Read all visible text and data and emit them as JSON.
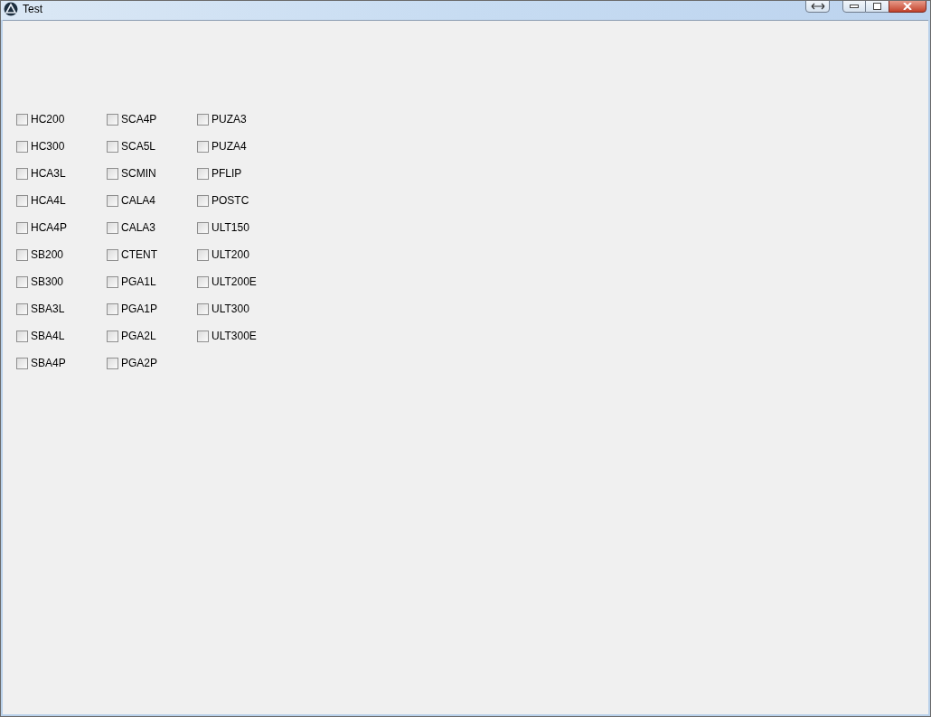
{
  "window": {
    "title": "Test"
  },
  "checkbox_columns": [
    [
      {
        "label": "HC200",
        "checked": false
      },
      {
        "label": "HC300",
        "checked": false
      },
      {
        "label": "HCA3L",
        "checked": false
      },
      {
        "label": "HCA4L",
        "checked": false
      },
      {
        "label": "HCA4P",
        "checked": false
      },
      {
        "label": "SB200",
        "checked": false
      },
      {
        "label": "SB300",
        "checked": false
      },
      {
        "label": "SBA3L",
        "checked": false
      },
      {
        "label": "SBA4L",
        "checked": false
      },
      {
        "label": "SBA4P",
        "checked": false
      }
    ],
    [
      {
        "label": "SCA4P",
        "checked": false
      },
      {
        "label": "SCA5L",
        "checked": false
      },
      {
        "label": "SCMIN",
        "checked": false
      },
      {
        "label": "CALA4",
        "checked": false
      },
      {
        "label": "CALA3",
        "checked": false
      },
      {
        "label": "CTENT",
        "checked": false
      },
      {
        "label": "PGA1L",
        "checked": false
      },
      {
        "label": "PGA1P",
        "checked": false
      },
      {
        "label": "PGA2L",
        "checked": false
      },
      {
        "label": "PGA2P",
        "checked": false
      }
    ],
    [
      {
        "label": "PUZA3",
        "checked": false
      },
      {
        "label": "PUZA4",
        "checked": false
      },
      {
        "label": "PFLIP",
        "checked": false
      },
      {
        "label": "POSTC",
        "checked": false
      },
      {
        "label": "ULT150",
        "checked": false
      },
      {
        "label": "ULT200",
        "checked": false
      },
      {
        "label": "ULT200E",
        "checked": false
      },
      {
        "label": "ULT300",
        "checked": false
      },
      {
        "label": "ULT300E",
        "checked": false
      }
    ]
  ]
}
